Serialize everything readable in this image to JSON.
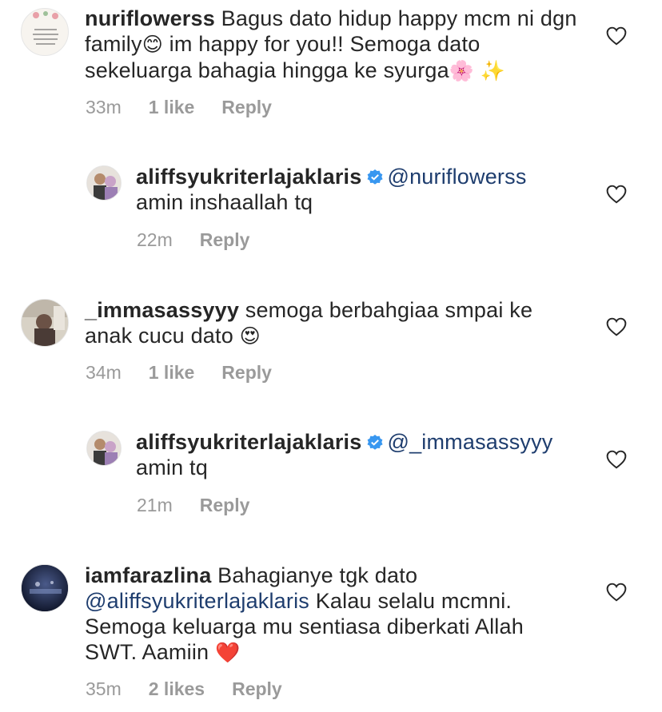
{
  "comments": [
    {
      "username": "nuriflowerss",
      "text_parts": [
        "Bagus dato hidup happy mcm ni dgn family",
        " im happy for you!! Semoga dato sekeluarga bahagia hingga ke syurga"
      ],
      "emojis": [
        "😊",
        "🌸",
        "✨"
      ],
      "time": "33m",
      "likes": "1 like",
      "reply": "Reply"
    },
    {
      "username": "aliffsyukriterlajaklaris",
      "mention": "@nuriflowerss",
      "text": "amin inshaallah tq",
      "time": "22m",
      "reply": "Reply"
    },
    {
      "username": "_immasassyyy",
      "text": "semoga berbahgiaa smpai ke anak cucu dato",
      "emojis": [
        "😍"
      ],
      "time": "34m",
      "likes": "1 like",
      "reply": "Reply"
    },
    {
      "username": "aliffsyukriterlajaklaris",
      "mention": "@_immasassyyy",
      "text": "amin tq",
      "time": "21m",
      "reply": "Reply"
    },
    {
      "username": "iamfarazlina",
      "text_before": "Bahagianye tgk dato",
      "mention": "@aliffsyukriterlajaklaris",
      "text_after": "Kalau selalu mcmni. Semoga keluarga mu sentiasa diberkati Allah SWT. Aamiin",
      "emojis": [
        "❤️"
      ],
      "time": "35m",
      "likes": "2 likes",
      "reply": "Reply"
    }
  ],
  "icons": {
    "like": "heart-outline-icon",
    "verified": "verified-badge-icon"
  },
  "colors": {
    "text": "#262626",
    "meta": "#9a9a9a",
    "mention": "#1e3d6e",
    "verified": "#3897f0"
  }
}
